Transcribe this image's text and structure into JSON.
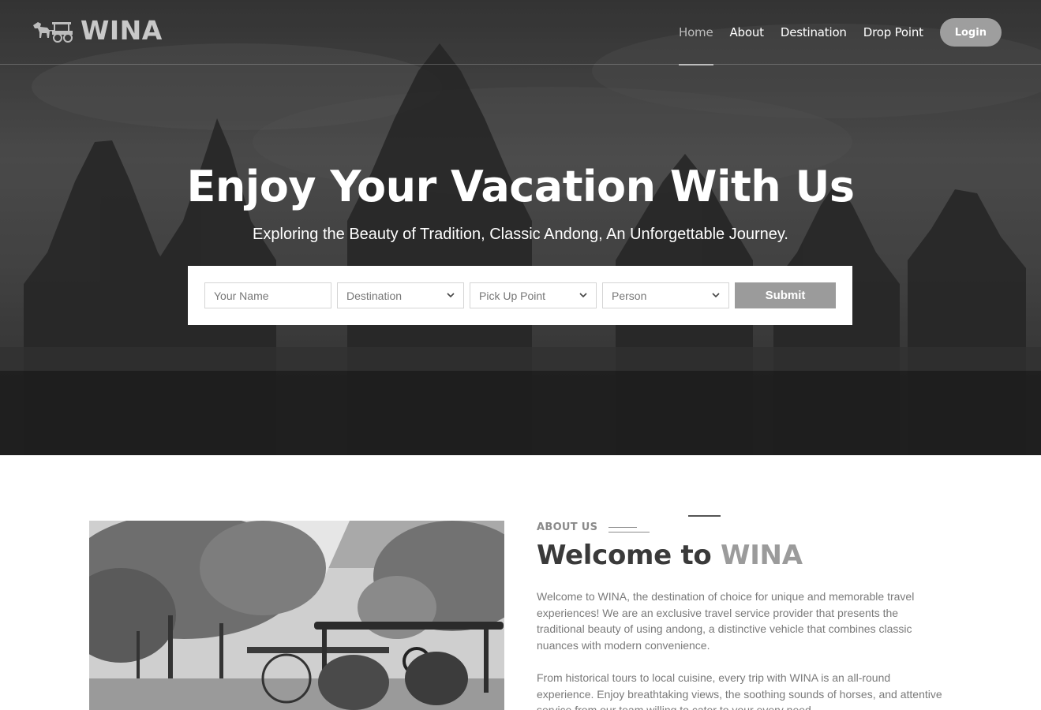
{
  "brand": {
    "name": "WINA",
    "logo_icon": "horse-carriage-icon"
  },
  "nav": {
    "items": [
      {
        "label": "Home",
        "active": true
      },
      {
        "label": "About",
        "active": false
      },
      {
        "label": "Destination",
        "active": false
      },
      {
        "label": "Drop Point",
        "active": false
      }
    ],
    "login_label": "Login"
  },
  "hero": {
    "title": "Enjoy Your Vacation With Us",
    "subtitle": "Exploring the Beauty of Tradition, Classic Andong, An Unforgettable Journey."
  },
  "booking": {
    "name_placeholder": "Your Name",
    "destination_placeholder": "Destination",
    "pickup_placeholder": "Pick Up Point",
    "person_placeholder": "Person",
    "submit_label": "Submit"
  },
  "about": {
    "eyebrow": "ABOUT US",
    "heading_prefix": "Welcome to ",
    "heading_accent": "WINA",
    "paragraph_1": "Welcome to WINA, the destination of choice for unique and memorable travel experiences! We are an exclusive travel service provider that presents the traditional beauty of using andong, a distinctive vehicle that combines classic nuances with modern convenience.",
    "paragraph_2": "From historical tours to local cuisine, every trip with WINA is an all-round experience. Enjoy breathtaking views, the soothing sounds of horses, and attentive service from our team willing to cater to your every need."
  },
  "colors": {
    "accent_gray": "#9b9b9b",
    "hero_overlay": "#3f3f3f",
    "text_dark": "#3a3a3a",
    "text_muted": "#7a7a7a"
  }
}
